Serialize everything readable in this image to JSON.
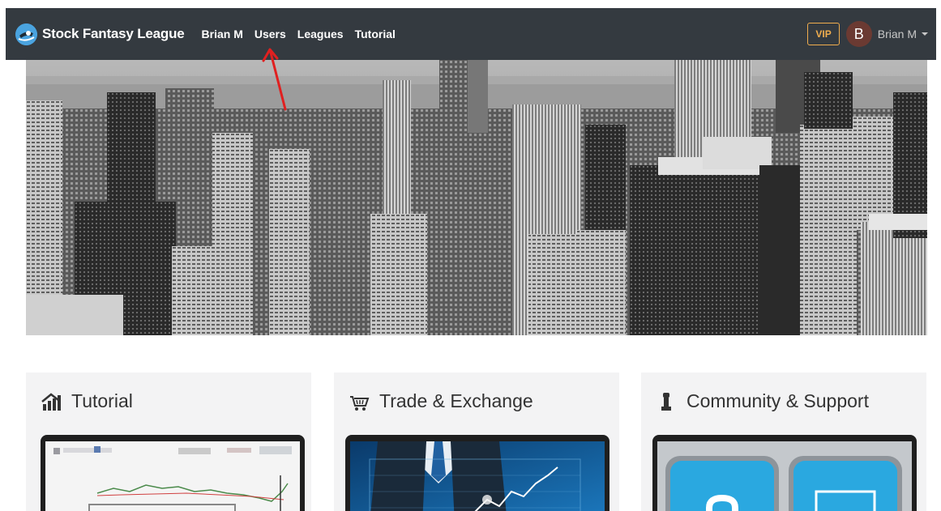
{
  "navbar": {
    "brand": "Stock Fantasy League",
    "links": [
      "Brian M",
      "Users",
      "Leagues",
      "Tutorial"
    ],
    "vip_label": "VIP",
    "avatar_letter": "B",
    "user_name": "Brian M"
  },
  "cards": [
    {
      "title": "Tutorial",
      "icon": "chart-bars-icon"
    },
    {
      "title": "Trade & Exchange",
      "icon": "shopping-cart-icon"
    },
    {
      "title": "Community & Support",
      "icon": "chess-rook-icon"
    }
  ],
  "colors": {
    "navbar_bg": "#343a40",
    "vip_accent": "#f0ad4e",
    "avatar_bg": "#6b3a32",
    "annotation_arrow": "#e02020"
  }
}
